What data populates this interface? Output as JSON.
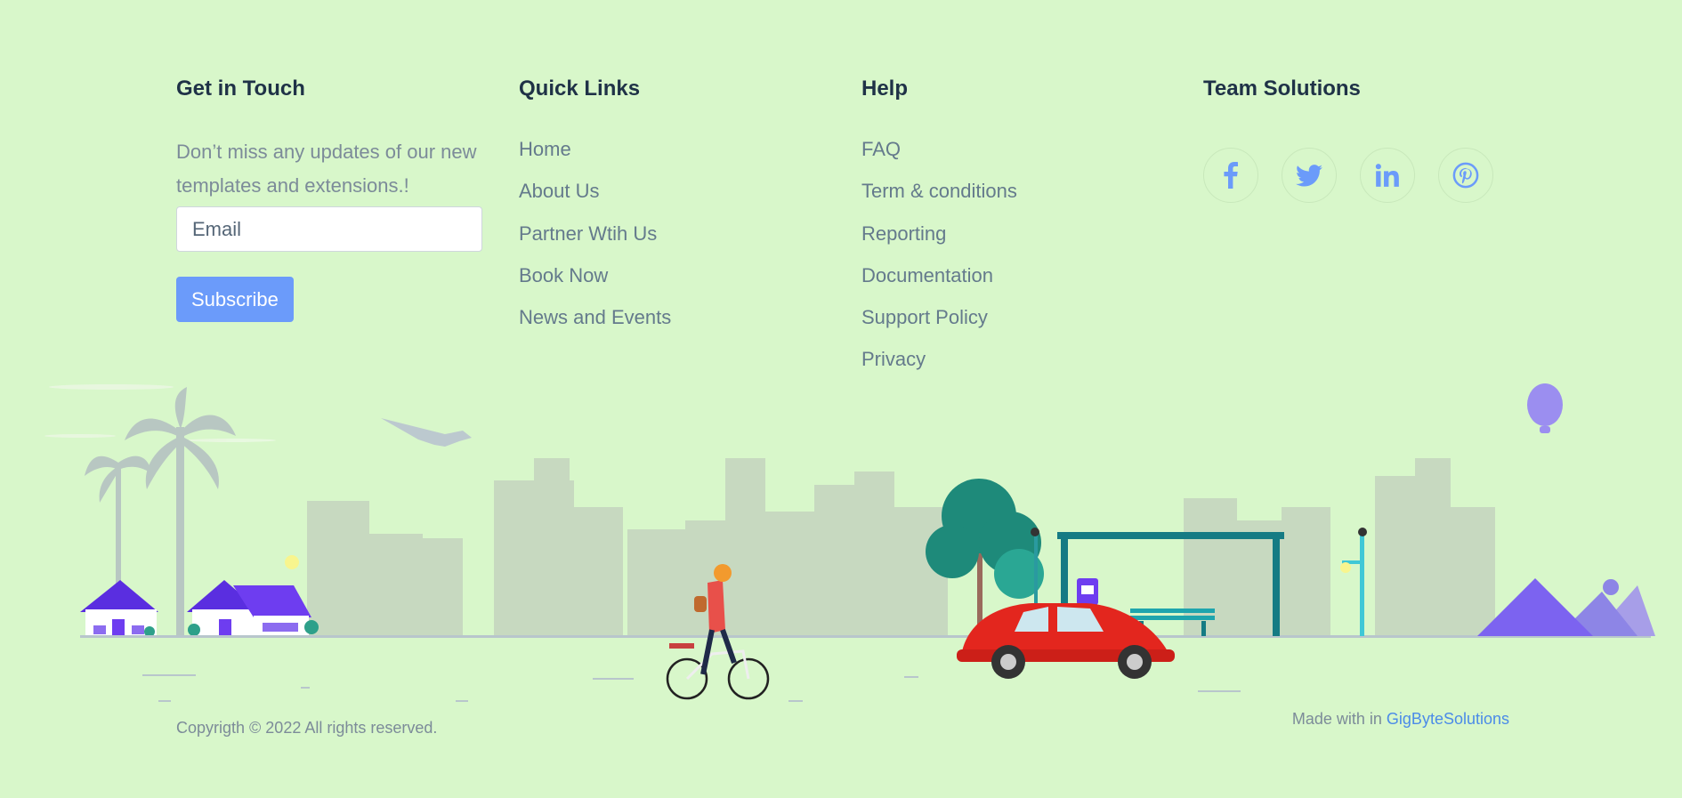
{
  "touch": {
    "heading": "Get in Touch",
    "desc_line1": "Don’t miss any updates of our new",
    "desc_line2": "templates and extensions.!",
    "email_placeholder": "Email",
    "subscribe_label": "Subscribe"
  },
  "quick_links": {
    "heading": "Quick Links",
    "items": [
      "Home",
      "About Us",
      "Partner Wtih Us",
      "Book Now",
      "News and Events"
    ]
  },
  "help": {
    "heading": "Help",
    "items": [
      "FAQ",
      "Term & conditions",
      "Reporting",
      "Documentation",
      "Support Policy",
      "Privacy"
    ]
  },
  "team": {
    "heading": "Team Solutions",
    "social": [
      "facebook-icon",
      "twitter-icon",
      "linkedin-icon",
      "pinterest-icon"
    ]
  },
  "bottom": {
    "copyright": "Copyrigth © 2022 All rights reserved.",
    "made_with": "Made with in",
    "brand": "GigByteSolutions"
  },
  "colors": {
    "background": "#d8f7ca",
    "accent": "#6b9bfa",
    "heading": "#1f3247",
    "link": "#647a8c",
    "brand_link": "#4b8be8"
  }
}
